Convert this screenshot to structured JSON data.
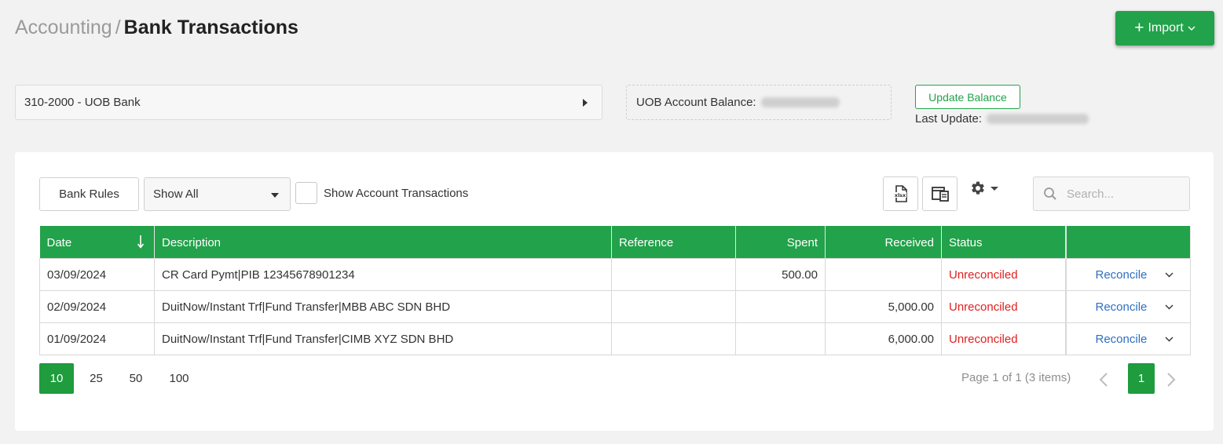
{
  "breadcrumb": {
    "parent": "Accounting",
    "separator": "/",
    "current": "Bank Transactions"
  },
  "import_button": {
    "plus": "+",
    "label": "Import"
  },
  "account_select": {
    "value": "310-2000 - UOB Bank"
  },
  "balance": {
    "label": "UOB Account Balance:"
  },
  "update_balance": {
    "label": "Update Balance",
    "last_update_label": "Last Update:"
  },
  "toolbar": {
    "bank_rules_label": "Bank Rules",
    "filter_value": "Show All",
    "show_account_transactions_label": "Show Account Transactions",
    "search_placeholder": "Search..."
  },
  "table": {
    "columns": [
      "Date",
      "Description",
      "Reference",
      "Spent",
      "Received",
      "Status",
      ""
    ],
    "rows": [
      {
        "date": "03/09/2024",
        "description": "CR Card Pymt|PIB 12345678901234",
        "reference": "",
        "spent": "500.00",
        "received": "",
        "status": "Unreconciled",
        "action": "Reconcile"
      },
      {
        "date": "02/09/2024",
        "description": "DuitNow/Instant Trf|Fund Transfer|MBB ABC SDN BHD",
        "reference": "",
        "spent": "",
        "received": "5,000.00",
        "status": "Unreconciled",
        "action": "Reconcile"
      },
      {
        "date": "01/09/2024",
        "description": "DuitNow/Instant Trf|Fund Transfer|CIMB XYZ SDN BHD",
        "reference": "",
        "spent": "",
        "received": "6,000.00",
        "status": "Unreconciled",
        "action": "Reconcile"
      }
    ]
  },
  "pagination": {
    "page_sizes": [
      "10",
      "25",
      "50",
      "100"
    ],
    "active_page_size": "10",
    "info": "Page 1 of 1 (3 items)",
    "current_page": "1"
  },
  "colors": {
    "accent": "#22a24a",
    "status_unreconciled": "#e02020",
    "link": "#2f6fc0"
  }
}
